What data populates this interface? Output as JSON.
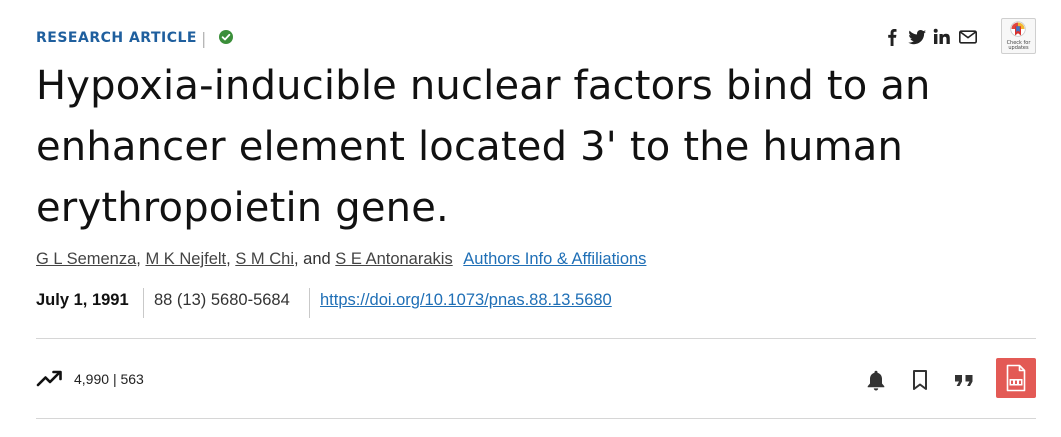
{
  "header": {
    "article_type": "RESEARCH ARTICLE",
    "separator": "|",
    "check_updates_label": "Check for updates",
    "share_icons": [
      "facebook-icon",
      "twitter-icon",
      "linkedin-icon",
      "email-icon"
    ]
  },
  "article": {
    "title": "Hypoxia-inducible nuclear factors bind to an enhancer element located 3' to the human erythropoietin gene.",
    "authors": [
      "G L Semenza",
      "M K Nejfelt",
      "S M Chi",
      "S E Antonarakis"
    ],
    "author_sep_1": ", ",
    "author_sep_2": ", ",
    "author_sep_3": ", and ",
    "affiliations_link": "Authors Info & Affiliations",
    "date": "July 1, 1991",
    "citation": "88 (13) 5680-5684",
    "doi": "https://doi.org/10.1073/pnas.88.13.5680"
  },
  "metrics": {
    "views": "4,990",
    "separator": "|",
    "citations": "563"
  },
  "actions": [
    "bell-icon",
    "bookmark-icon",
    "quote-icon",
    "pdf-icon"
  ],
  "colors": {
    "accent_blue": "#1f5f9e",
    "link_blue": "#1f6fb6",
    "check_green": "#3b8f3a",
    "pdf_red": "#e35a55"
  }
}
